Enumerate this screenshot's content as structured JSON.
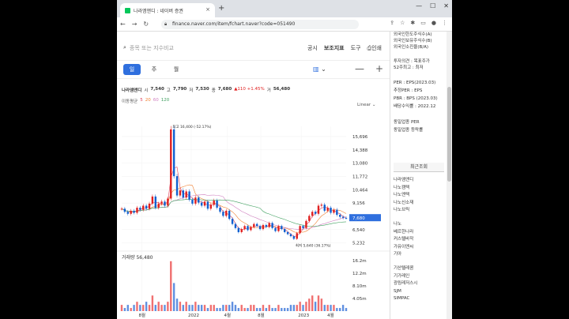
{
  "tab": {
    "title": "나라엠앤디 : 네이버 증권",
    "close": "×",
    "new": "+"
  },
  "window": {
    "min": "—",
    "max": "☐",
    "close": "✕"
  },
  "address": {
    "url": "finance.naver.com/item/fchart.naver?code=051490"
  },
  "toolbar": {
    "search_placeholder": "종목 또는 지수비교",
    "items": [
      "공시",
      "보조지표",
      "도구",
      "인쇄"
    ]
  },
  "period": {
    "tabs": [
      "일",
      "주",
      "월"
    ],
    "active": 0
  },
  "zoom": {
    "minus": "—",
    "plus": "+"
  },
  "info": {
    "name": "나라엠앤디",
    "open_label": "시",
    "open": "7,540",
    "high_label": "고",
    "high": "7,790",
    "low_label": "저",
    "low": "7,530",
    "close_label": "종",
    "close": "7,680",
    "change": "▲110 +1.45%",
    "vol_label": "거",
    "vol": "56,480"
  },
  "ma": {
    "label": "이동평균",
    "items": [
      {
        "text": "5",
        "color": "#e0405a"
      },
      {
        "text": "20",
        "color": "#f08030"
      },
      {
        "text": "60",
        "color": "#d080c0"
      },
      {
        "text": "120",
        "color": "#40a060"
      }
    ]
  },
  "scale": "Linear",
  "volume_label": "거래량 56,480",
  "chart_data": {
    "type": "line",
    "ylabels": [
      "15,696",
      "14,388",
      "13,080",
      "11,772",
      "10,464",
      "9,156",
      "7,848",
      "6,540",
      "5,232"
    ],
    "last_price": "7,680",
    "max_label": "최고 16,400 (-52.17%)",
    "min_label": "최저 5,640 (36.17%)",
    "xlabels": [
      "8월",
      "2022",
      "4월",
      "8월",
      "2023",
      "4월"
    ],
    "vol_ylabels": [
      "16.2m",
      "12.2m",
      "8.10m",
      "4.05m"
    ],
    "prices": [
      8600,
      8300,
      8100,
      8400,
      8200,
      8700,
      8500,
      8900,
      8600,
      9100,
      9800,
      8700,
      9100,
      9300,
      8900,
      9600,
      16400,
      11800,
      9900,
      10400,
      9700,
      10300,
      9500,
      9100,
      9700,
      9200,
      8900,
      9300,
      8600,
      9000,
      9400,
      8700,
      8300,
      7900,
      8400,
      7600,
      7100,
      6700,
      6300,
      6600,
      6900,
      6500,
      6800,
      7100,
      6900,
      6600,
      7000,
      6800,
      7200,
      6700,
      6400,
      6900,
      6600,
      6300,
      6100,
      5900,
      5640,
      6200,
      6900,
      6700,
      7400,
      7900,
      8300,
      8100,
      8900,
      9000,
      8400,
      8700,
      8200,
      8500,
      8000,
      7800,
      7700,
      7680
    ],
    "volumes": [
      2,
      1,
      2,
      1,
      2,
      3,
      2,
      2,
      3,
      2,
      5,
      2,
      3,
      2,
      2,
      3,
      16,
      9,
      4,
      3,
      2,
      3,
      2,
      2,
      3,
      2,
      2,
      2,
      1,
      2,
      2,
      1,
      1,
      2,
      2,
      2,
      3,
      2,
      1,
      2,
      1,
      1,
      2,
      2,
      1,
      1,
      2,
      1,
      2,
      1,
      1,
      2,
      1,
      1,
      1,
      2,
      2,
      2,
      3,
      2,
      3,
      4,
      5,
      3,
      5,
      4,
      2,
      2,
      2,
      2,
      1,
      1,
      2,
      1
    ]
  },
  "side": {
    "top_rows": [
      "외국인한도주식수(A)",
      "외국인보유주식수(B)",
      "외국인소진율(B/A)"
    ],
    "mid_rows": [
      "투자의견 : 목표주가",
      "52주최고 : 최저"
    ],
    "per_rows": [
      "PER : EPS(2023.03)",
      "추정PER : EPS",
      "PBR : BPS (2023.03)",
      "배당수익률 : 2022.12"
    ],
    "sector_rows": [
      "동일업종 PER",
      "동일업종 등락률"
    ],
    "recent_title": "최근조회",
    "recent_items": [
      "나라엠앤디",
      "나노캠텍",
      "나노엔텍",
      "나노신소재",
      "나노브릭",
      "나노",
      "베르한나라",
      "커스텔바작",
      "가유이엔씨",
      "기아",
      "기산텔레콤",
      "기가레인",
      "광림레저스시",
      "SJM",
      "SIMPAC"
    ]
  }
}
